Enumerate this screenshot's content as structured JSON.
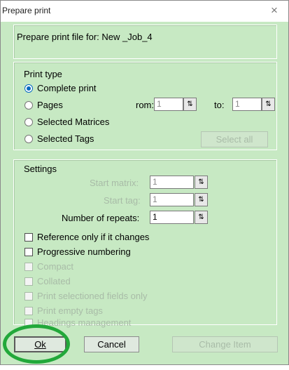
{
  "window": {
    "title": "Prepare print",
    "close_glyph": "×"
  },
  "header": {
    "prepare_label": "Prepare print file for: New _Job_4"
  },
  "print_type": {
    "heading": "Print type",
    "options": [
      "Complete print",
      "Pages",
      "Selected Matrices",
      "Selected Tags"
    ],
    "selected": "Complete print",
    "from_label": "rom:",
    "from_value": "1",
    "to_label": "to:",
    "to_value": "1",
    "select_all_label": "Select all"
  },
  "settings": {
    "heading": "Settings",
    "start_matrix_label": "Start matrix:",
    "start_matrix_value": "1",
    "start_tag_label": "Start tag:",
    "start_tag_value": "1",
    "repeats_label": "Number of repeats:",
    "repeats_value": "1",
    "checkboxes": [
      {
        "label": "Reference only if it changes",
        "checked": false,
        "enabled": true
      },
      {
        "label": "Progressive numbering",
        "checked": false,
        "enabled": true
      },
      {
        "label": "Compact",
        "checked": false,
        "enabled": false
      },
      {
        "label": "Collated",
        "checked": false,
        "enabled": false
      },
      {
        "label": "Print selectioned fields only",
        "checked": false,
        "enabled": false
      },
      {
        "label": "Print empty tags",
        "checked": false,
        "enabled": false
      },
      {
        "label": "Headings management",
        "checked": false,
        "enabled": false
      }
    ]
  },
  "buttons": {
    "ok_label": "Ok",
    "cancel_label": "Cancel",
    "change_item_label": "Change Item"
  },
  "spin_glyph": "⇅",
  "colors": {
    "dialog_bg": "#c7e9c3",
    "accent": "#0067c0",
    "highlight_ring": "#22a83a"
  }
}
